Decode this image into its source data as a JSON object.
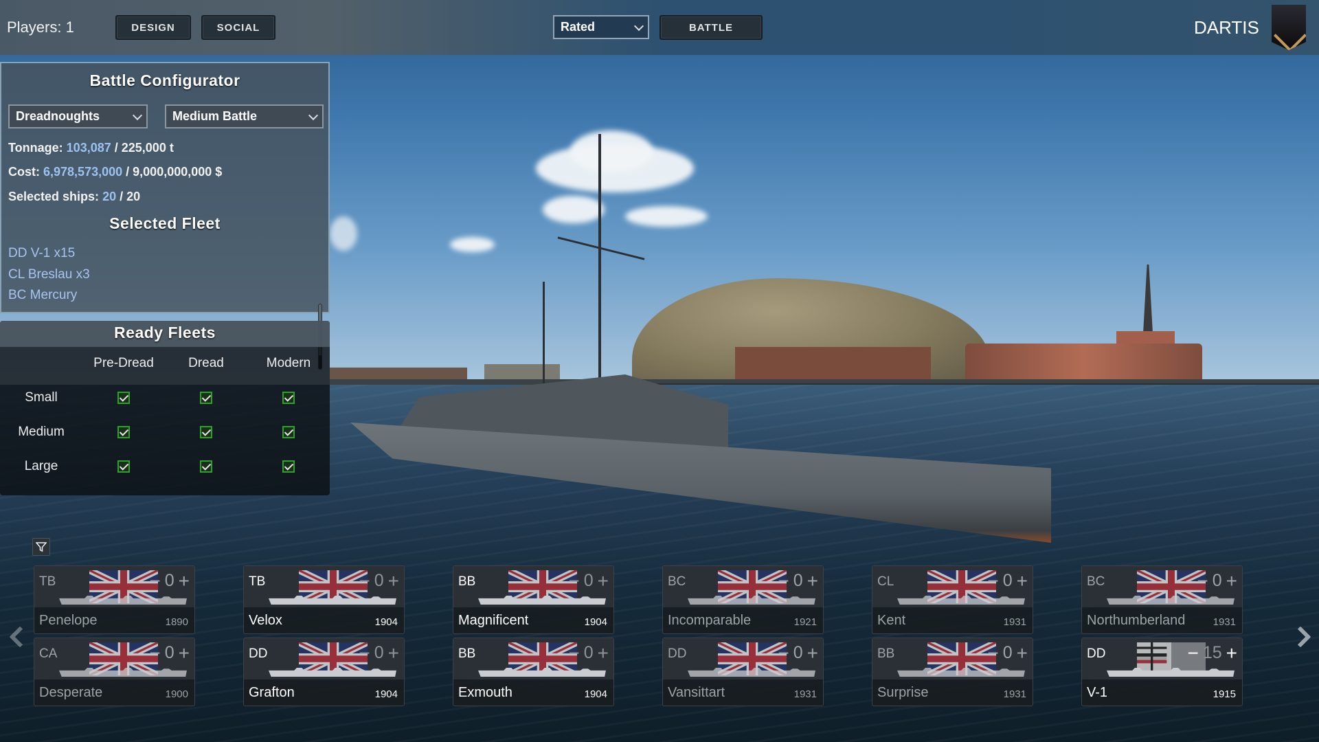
{
  "topbar": {
    "players_label": "Players: 1",
    "design_label": "DESIGN",
    "social_label": "SOCIAL",
    "mode_select": "Rated",
    "battle_label": "BATTLE",
    "username": "DARTIS",
    "rank_icon": "rank-chevron-icon"
  },
  "config": {
    "title": "Battle Configurator",
    "era_select": "Dreadnoughts",
    "size_select": "Medium Battle",
    "tonnage_label": "Tonnage:",
    "tonnage_value": "103,087",
    "tonnage_max": "/ 225,000 t",
    "cost_label": "Cost:",
    "cost_value": "6,978,573,000",
    "cost_max": "/ 9,000,000,000 $",
    "ships_label": "Selected ships:",
    "ships_value": "20",
    "ships_max": "/ 20",
    "fleet_title": "Selected Fleet",
    "fleet_items": [
      "DD V-1 x15",
      "CL Breslau x3",
      "BC Mercury"
    ]
  },
  "ready": {
    "title": "Ready Fleets",
    "columns": [
      "Pre-Dread",
      "Dread",
      "Modern"
    ],
    "rows": [
      {
        "label": "Small",
        "checked": [
          true,
          true,
          true
        ]
      },
      {
        "label": "Medium",
        "checked": [
          true,
          true,
          true
        ]
      },
      {
        "label": "Large",
        "checked": [
          true,
          true,
          true
        ]
      }
    ]
  },
  "ships": [
    {
      "type": "TB",
      "name": "Penelope",
      "year": "1890",
      "count": "0",
      "state": "dim",
      "flag": "uk"
    },
    {
      "type": "TB",
      "name": "Velox",
      "year": "1904",
      "count": "0",
      "state": "active",
      "flag": "uk"
    },
    {
      "type": "BB",
      "name": "Magnificent",
      "year": "1904",
      "count": "0",
      "state": "active",
      "flag": "uk"
    },
    {
      "type": "BC",
      "name": "Incomparable",
      "year": "1921",
      "count": "0",
      "state": "dim",
      "flag": "uk"
    },
    {
      "type": "CL",
      "name": "Kent",
      "year": "1931",
      "count": "0",
      "state": "dim",
      "flag": "uk"
    },
    {
      "type": "BC",
      "name": "Northumberland",
      "year": "1931",
      "count": "0",
      "state": "dim",
      "flag": "uk"
    },
    {
      "type": "CA",
      "name": "Desperate",
      "year": "1900",
      "count": "0",
      "state": "dim",
      "flag": "uk"
    },
    {
      "type": "DD",
      "name": "Grafton",
      "year": "1904",
      "count": "0",
      "state": "active",
      "flag": "uk"
    },
    {
      "type": "BB",
      "name": "Exmouth",
      "year": "1904",
      "count": "0",
      "state": "active",
      "flag": "uk"
    },
    {
      "type": "DD",
      "name": "Vansittart",
      "year": "1931",
      "count": "0",
      "state": "dim",
      "flag": "uk"
    },
    {
      "type": "BB",
      "name": "Surprise",
      "year": "1931",
      "count": "0",
      "state": "dim",
      "flag": "uk"
    },
    {
      "type": "DD",
      "name": "V-1",
      "year": "1915",
      "count": "15",
      "state": "selected",
      "flag": "german-imperial"
    }
  ],
  "controls": {
    "minus": "−",
    "plus": "+",
    "filter_icon": "filter-icon"
  },
  "colors": {
    "highlight_value": "#9ec2f0",
    "fleet_item": "#a9c4ee",
    "checkbox_border": "#2fa12c",
    "selected_count": "#3ddc28",
    "rank_stripe": "#c39a5a"
  }
}
